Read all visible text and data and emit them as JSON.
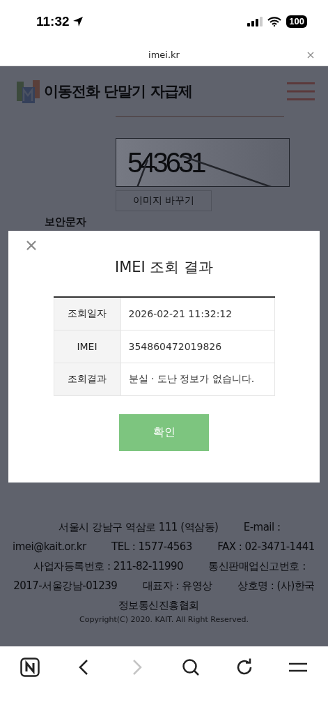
{
  "status_bar": {
    "time": "11:32",
    "battery": "100"
  },
  "address_bar": {
    "url": "imei.kr"
  },
  "page": {
    "site_title": "이동전화 단말기 자급제",
    "captcha": "543631",
    "refresh_captcha_button": "이미지 바꾸기",
    "captcha_label": "보안문자",
    "footer": [
      "서울시 강남구 역삼로 111 (역삼동)",
      "E-mail : imei@kait.or.kr",
      "TEL : 1577-4563",
      "FAX : 02-3471-1441",
      "사업자등록번호 : 211-82-11990",
      "통신판매업신고번호 : 2017-서울강남-01239",
      "대표자 : 유영상",
      "상호명 : (사)한국정보통신진흥협회"
    ],
    "copyright": "Copyright(C) 2020. KAIT. All Right Reserved."
  },
  "dialog": {
    "title": "IMEI 조회 결과",
    "rows": [
      {
        "label": "조회일자",
        "value": "2026-02-21 11:32:12"
      },
      {
        "label": "IMEI",
        "value": "354860472019826"
      },
      {
        "label": "조회결과",
        "value": "분실 · 도난 정보가 없습니다."
      }
    ],
    "confirm_button": "확인"
  },
  "toolbar": [
    {
      "kind": "home",
      "disabled": false
    },
    {
      "kind": "back",
      "disabled": false
    },
    {
      "kind": "forward",
      "disabled": true
    },
    {
      "kind": "search",
      "disabled": false
    },
    {
      "kind": "reload",
      "disabled": false
    },
    {
      "kind": "menu",
      "disabled": false
    }
  ]
}
